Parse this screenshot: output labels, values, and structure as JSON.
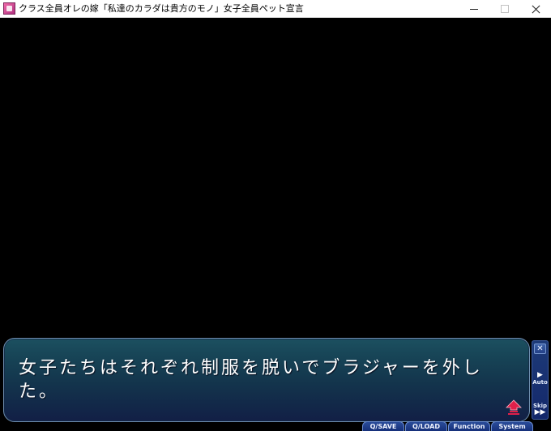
{
  "window": {
    "title": "クラス全員オレの嫁「私達のカラダは貴方のモノ」女子全員ペット宣言"
  },
  "message": {
    "text": "女子たちはそれぞれ制服を脱いでブラジャーを外した。"
  },
  "side_panel": {
    "hide_glyph": "✕",
    "auto_glyph": "▶",
    "auto_label": "Auto",
    "skip_glyph": "▶▶",
    "skip_label": "Skip"
  },
  "menu": {
    "qsave": "Q/SAVE",
    "qload": "Q/LOAD",
    "function": "Function",
    "system": "System"
  },
  "colors": {
    "message_box_top": "#1c5060",
    "message_box_bottom": "#121f46",
    "next_arrow": "#e0204a",
    "menu_bg": "#16307a"
  },
  "icons": {
    "app": "app-icon",
    "next": "next-page-arrow-icon"
  }
}
